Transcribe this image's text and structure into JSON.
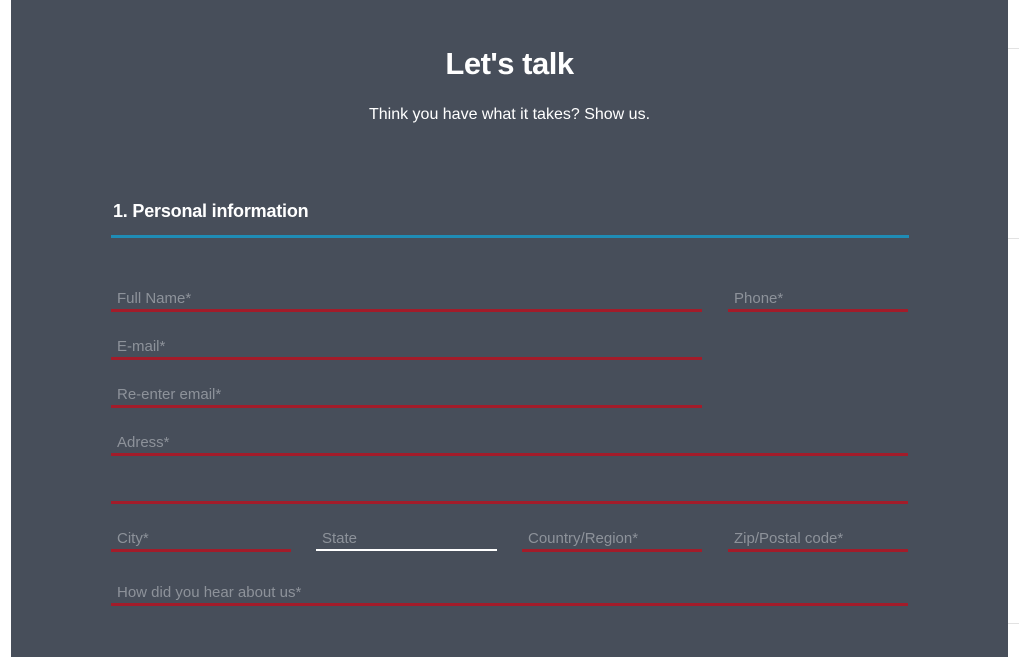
{
  "header": {
    "title": "Let's talk",
    "subtitle": "Think you have what it takes? Show us."
  },
  "section": {
    "heading": "1. Personal information"
  },
  "form": {
    "full_name": {
      "placeholder": "Full Name*",
      "value": ""
    },
    "phone": {
      "placeholder": "Phone*",
      "value": ""
    },
    "email": {
      "placeholder": "E-mail*",
      "value": ""
    },
    "reenter_email": {
      "placeholder": "Re-enter email*",
      "value": ""
    },
    "address": {
      "placeholder": "Adress*",
      "value": ""
    },
    "address_line2": {
      "placeholder": "",
      "value": ""
    },
    "city": {
      "placeholder": "City*",
      "value": ""
    },
    "state": {
      "placeholder": "State",
      "value": ""
    },
    "country": {
      "placeholder": "Country/Region*",
      "value": ""
    },
    "zip": {
      "placeholder": "Zip/Postal code*",
      "value": ""
    },
    "referral": {
      "placeholder": "How did you hear about us*",
      "value": ""
    }
  },
  "colors": {
    "panel_background": "#474e5a",
    "section_rule": "#1f8cb5",
    "invalid_underline": "#a31c2a",
    "placeholder_text": "#8d929a",
    "text": "#ffffff"
  }
}
